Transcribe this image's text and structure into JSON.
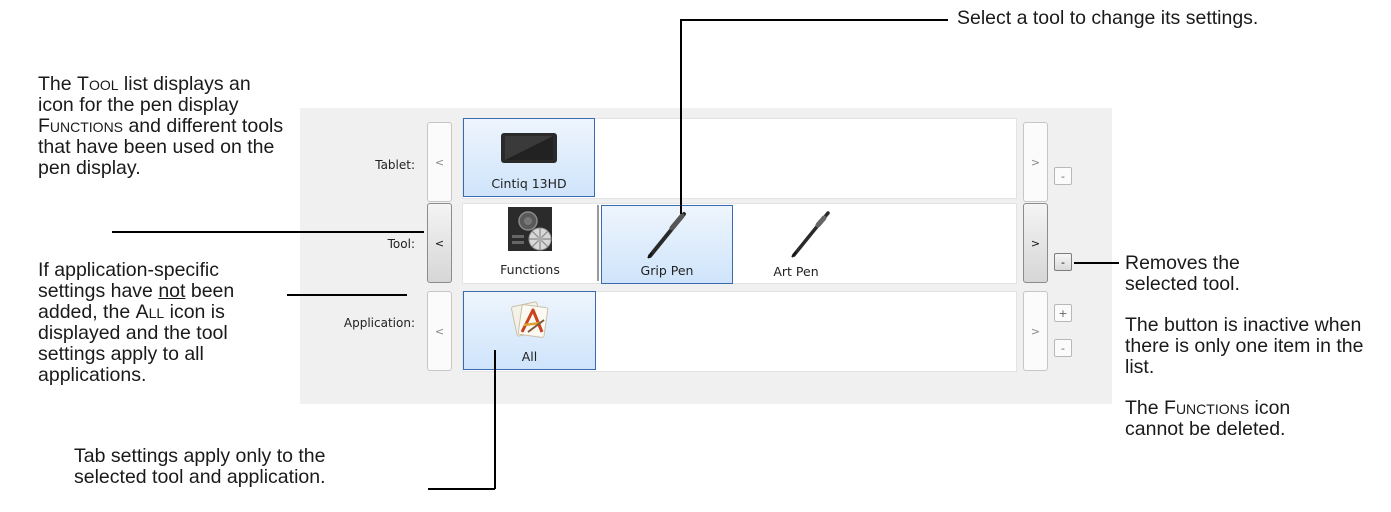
{
  "notes": {
    "select_tool": "Select a tool to change its settings.",
    "tool_list": {
      "p1": "The ",
      "p1_sc": "Tool",
      "p2": " list displays an icon for the pen display ",
      "p2_sc": "Functions",
      "p3": " and different tools that have been used on the pen display."
    },
    "app_specific": {
      "p1": "If application-specific settings have ",
      "p1_u": "not",
      "p2": " been added, the ",
      "p2_sc": "All",
      "p3": " icon is displayed and the tool settings apply to all applications."
    },
    "tab_settings": "Tab settings apply only to the selected tool and application.",
    "removes": "Removes the selected tool.",
    "inactive": "The button is inactive when there is only one item in the list.",
    "functions_icon": {
      "p1": "The ",
      "p1_sc": "Functions",
      "p2": " icon cannot be deleted."
    }
  },
  "panel": {
    "rows": [
      {
        "label": "Tablet:",
        "items": [
          "Cintiq 13HD"
        ]
      },
      {
        "label": "Tool:",
        "items": [
          "Functions",
          "Grip Pen",
          "Art Pen"
        ]
      },
      {
        "label": "Application:",
        "items": [
          "All"
        ]
      }
    ],
    "prev": "<",
    "next": ">",
    "add": "+",
    "remove": "-"
  },
  "icons": {
    "tablet": "cintiq-tablet-icon",
    "functions": "functions-icon",
    "grip_pen": "grip-pen-icon",
    "art_pen": "art-pen-icon",
    "all_apps": "all-applications-icon"
  },
  "colors": {
    "selection_fill": "#cfe4fb",
    "selection_border": "#3a6ab0",
    "panel_bg": "#f0f0f0"
  }
}
